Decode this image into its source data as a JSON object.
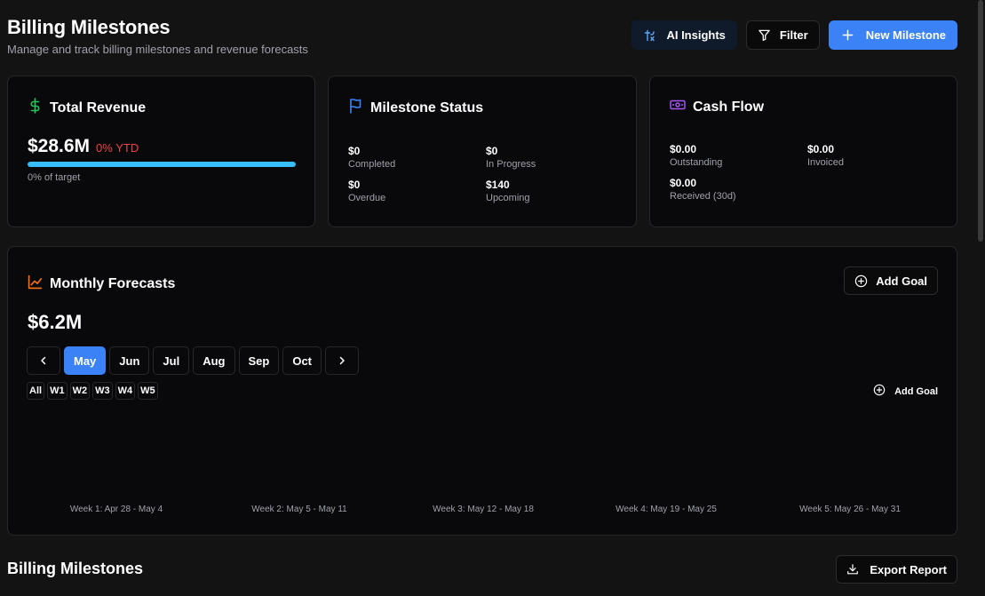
{
  "header": {
    "title": "Billing Milestones",
    "subtitle": "Manage and track billing milestones and revenue forecasts"
  },
  "actions": {
    "ai_insights": "AI Insights",
    "filter": "Filter",
    "new_milestone": "New Milestone"
  },
  "total_revenue": {
    "title": "Total Revenue",
    "value": "$28.6M",
    "ytd": "0% YTD",
    "progress": 1.0,
    "progress_label": "0% of target"
  },
  "milestone_status": {
    "title": "Milestone Status",
    "items": [
      {
        "value": "$0",
        "label": "Completed"
      },
      {
        "value": "$0",
        "label": "In Progress"
      },
      {
        "value": "$0",
        "label": "Overdue"
      },
      {
        "value": "$140",
        "label": "Upcoming"
      }
    ]
  },
  "cash_flow": {
    "title": "Cash Flow",
    "items": [
      {
        "value": "$0.00",
        "label": "Outstanding"
      },
      {
        "value": "$0.00",
        "label": "Invoiced"
      },
      {
        "value": "$0.00",
        "label": "Received (30d)"
      }
    ]
  },
  "forecasts": {
    "title": "Monthly Forecasts",
    "value": "$6.2M",
    "add_goal": "Add Goal",
    "add_goal_secondary": "Add Goal",
    "months": [
      "May",
      "Jun",
      "Jul",
      "Aug",
      "Sep",
      "Oct"
    ],
    "active_month": "May",
    "weeks": [
      "All",
      "W1",
      "W2",
      "W3",
      "W4",
      "W5"
    ],
    "week_labels": [
      "Week 1: Apr 28 - May 4",
      "Week 2: May 5 - May 11",
      "Week 3: May 12 - May 18",
      "Week 4: May 19 - May 25",
      "Week 5: May 26 - May 31"
    ]
  },
  "section": {
    "title": "Billing Milestones",
    "export": "Export Report"
  },
  "colors": {
    "accent": "#3b82f6",
    "revenue_icon": "#22c55e",
    "status_icon": "#3b82f6",
    "cashflow_icon": "#a855f7",
    "forecast_icon": "#f97316",
    "negative": "#ef4444",
    "progress": "#38bdf8"
  },
  "icons": {
    "ai": "ai-sparkle-icon",
    "filter": "filter-icon",
    "plus": "plus-icon",
    "dollar": "dollar-icon",
    "flag": "flag-icon",
    "banknote": "banknote-icon",
    "trend": "trend-chart-icon",
    "plus_circle": "plus-circle-icon",
    "chevron_left": "chevron-left-icon",
    "chevron_right": "chevron-right-icon",
    "download": "download-icon"
  }
}
